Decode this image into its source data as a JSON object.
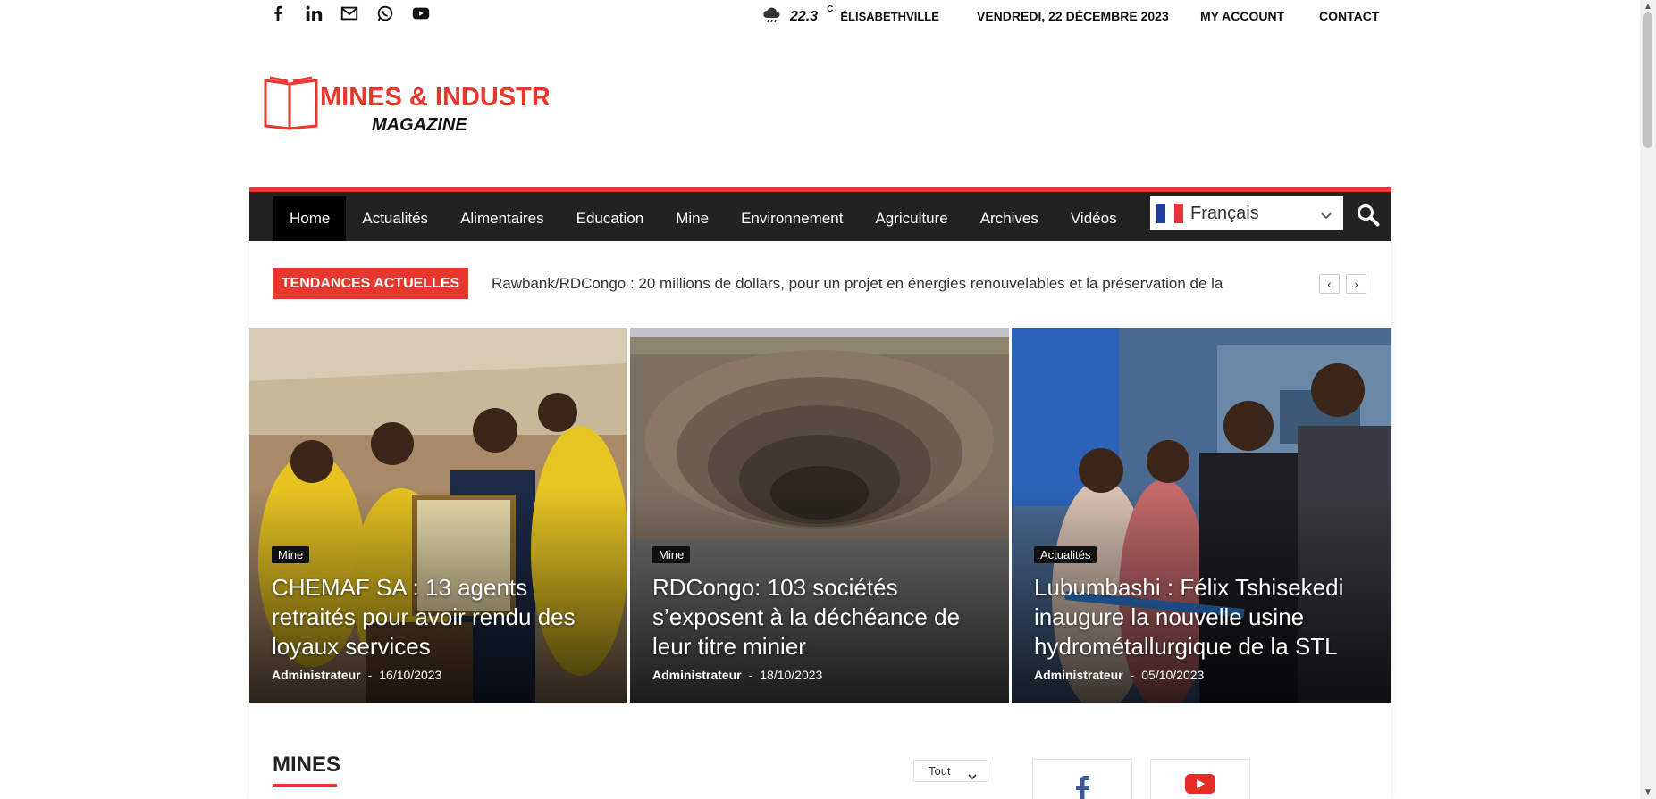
{
  "social": {
    "icons": [
      "facebook-icon",
      "linkedin-icon",
      "mail-icon",
      "whatsapp-icon",
      "youtube-icon"
    ]
  },
  "weather": {
    "temp": "22.3",
    "unit": "C",
    "city": "Élisabethville"
  },
  "header": {
    "date": "VENDREDI, 22 DÉCEMBRE 2023",
    "my_account": "MY ACCOUNT",
    "contact": "CONTACT"
  },
  "logo": {
    "line1": "MINES & INDUSTRIES",
    "line2": "MAGAZINE",
    "color": "#e8372c"
  },
  "nav": {
    "items": [
      "Home",
      "Actualités",
      "Alimentaires",
      "Education",
      "Mine",
      "Environnement",
      "Agriculture",
      "Archives",
      "Vidéos"
    ],
    "active": "Home",
    "language": "Français"
  },
  "trending": {
    "label": "TENDANCES ACTUELLES",
    "text": "Rawbank/RDCongo : 20 millions de dollars, pour un projet en énergies renouvelables et la préservation de la",
    "prev": "‹",
    "next": "›"
  },
  "featured": [
    {
      "category": "Mine",
      "title": "CHEMAF SA : 13 agents retraités pour avoir rendu des loyaux services",
      "author": "Administrateur",
      "date": "16/10/2023"
    },
    {
      "category": "Mine",
      "title": "RDCongo: 103 sociétés s’exposent à la déchéance de leur titre minier",
      "author": "Administrateur",
      "date": "18/10/2023"
    },
    {
      "category": "Actualités",
      "title": "Lubumbashi : Félix Tshisekedi inaugure la nouvelle usine hydrométallurgique de la STL",
      "author": "Administrateur",
      "date": "05/10/2023"
    }
  ],
  "section": {
    "title": "MINES",
    "filter": "Tout"
  },
  "colors": {
    "accent": "#e8372c",
    "nav_bg": "#222222"
  }
}
